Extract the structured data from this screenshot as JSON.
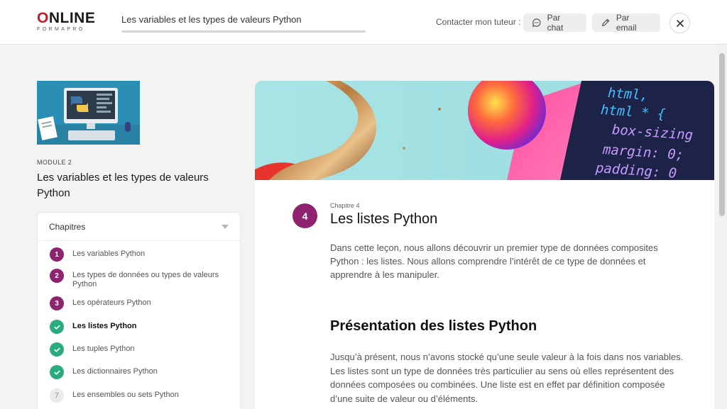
{
  "header": {
    "logo_main": "ONLINE",
    "logo_sub": "FORMAPRO",
    "course_title": "Les variables et les types de valeurs Python",
    "contact_label": "Contacter mon tuteur :",
    "chat_label": "Par chat",
    "email_label": "Par email",
    "icons": [
      "chat-icon",
      "pencil-icon",
      "close-icon"
    ]
  },
  "sidebar": {
    "module_label": "MODULE 2",
    "module_title": "Les variables et les types de valeurs Python",
    "chapters_heading": "Chapitres",
    "chapters": [
      {
        "num": "1",
        "label": "Les variables Python",
        "status": "in-progress"
      },
      {
        "num": "2",
        "label": "Les types de données ou types de valeurs Python",
        "status": "in-progress"
      },
      {
        "num": "3",
        "label": "Les opérateurs Python",
        "status": "in-progress"
      },
      {
        "num": "4",
        "label": "Les listes Python",
        "status": "done",
        "active": true
      },
      {
        "num": "5",
        "label": "Les tuples Python",
        "status": "done"
      },
      {
        "num": "6",
        "label": "Les dictionnaires Python",
        "status": "done"
      },
      {
        "num": "7",
        "label": "Les ensembles ou sets Python",
        "status": "todo"
      }
    ]
  },
  "main": {
    "banner_code": [
      "html,",
      "html * {",
      "box-sizing",
      "margin: 0;",
      "padding: 0"
    ],
    "chapter_number": "4",
    "chapter_kicker": "Chapitre 4",
    "chapter_title": "Les listes Python",
    "intro": "Dans cette leçon, nous allons découvrir un premier type de données composites Python : les listes. Nous allons comprendre l’intérêt de ce type de données et apprendre à les manipuler.",
    "section_title": "Présentation des listes Python",
    "body": "Jusqu’à présent, nous n’avons stocké qu’une seule valeur à la fois dans nos variables. Les listes sont un type de données très particulier au sens où elles représentent des données composées ou combinées. Une liste est en effet par définition composée d’une suite de valeur ou d’éléments."
  },
  "colors": {
    "accent_purple": "#8e2470",
    "done_green": "#2bab7a",
    "logo_red": "#c0202a"
  }
}
